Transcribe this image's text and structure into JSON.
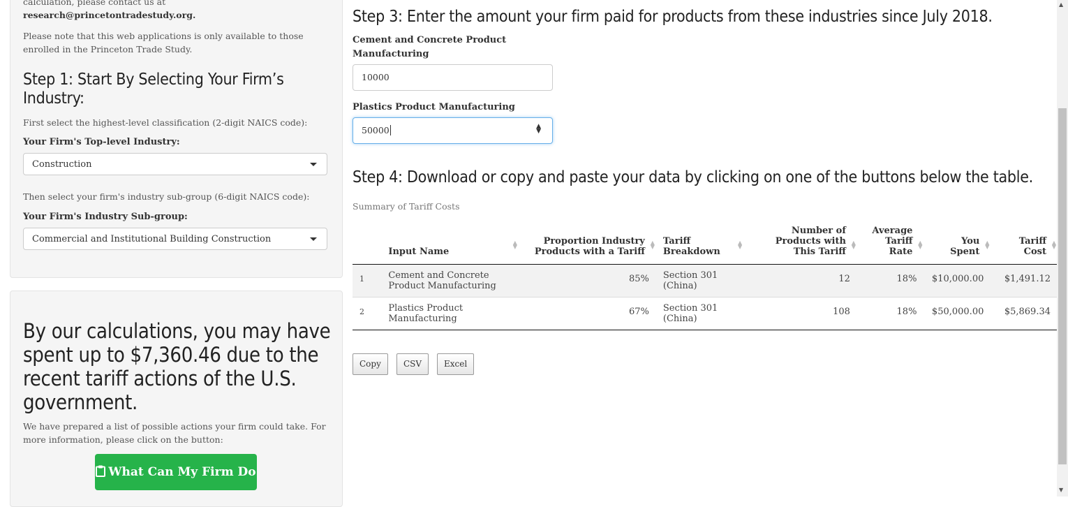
{
  "sidebar": {
    "contact_text": "calculation, please contact us at",
    "contact_email": "research@princetontradestudy.org.",
    "note": "Please note that this web applications is only available to those enrolled in the Princeton Trade Study.",
    "step1_title": "Step 1: Start By Selecting Your Firm’s Industry:",
    "step1_hint": "First select the highest-level classification (2-digit NAICS code):",
    "top_level_label": "Your Firm's Top-level Industry:",
    "top_level_value": "Construction",
    "subgroup_hint": "Then select your firm's industry sub-group (6-digit NAICS code):",
    "subgroup_label": "Your Firm's Industry Sub-group:",
    "subgroup_value": "Commercial and Institutional Building Construction"
  },
  "result": {
    "headline": "By our calculations, you may have spent up to $7,360.46 due to the recent tariff actions of the U.S. government.",
    "info": "We have prepared a list of possible actions your firm could take. For more information, please click on the button:",
    "button_label": "What Can My Firm Do"
  },
  "step3": {
    "title": "Step 3: Enter the amount your firm paid for products from these industries since July 2018.",
    "inputs": [
      {
        "label": "Cement and Concrete Product Manufacturing",
        "value": "10000"
      },
      {
        "label": "Plastics Product Manufacturing",
        "value": "50000"
      }
    ]
  },
  "step4": {
    "title": "Step 4: Download or copy and paste your data by clicking on one of the buttons below the table.",
    "caption": "Summary of Tariff Costs",
    "columns": [
      "",
      "Input Name",
      "Proportion Industry Products with a Tariff",
      "Tariff Breakdown",
      "Number of Products with This Tariff",
      "Average Tariff Rate",
      "You Spent",
      "Tariff Cost"
    ],
    "rows": [
      [
        "1",
        "Cement and Concrete Product Manufacturing",
        "85%",
        "Section 301 (China)",
        "12",
        "18%",
        "$10,000.00",
        "$1,491.12"
      ],
      [
        "2",
        "Plastics Product Manufacturing",
        "67%",
        "Section 301 (China)",
        "108",
        "18%",
        "$50,000.00",
        "$5,869.34"
      ]
    ],
    "buttons": [
      "Copy",
      "CSV",
      "Excel"
    ]
  },
  "icons": {
    "button_icon": "clipboard-icon",
    "sort": "sort-icon",
    "dropdown": "chevron-down-icon"
  }
}
